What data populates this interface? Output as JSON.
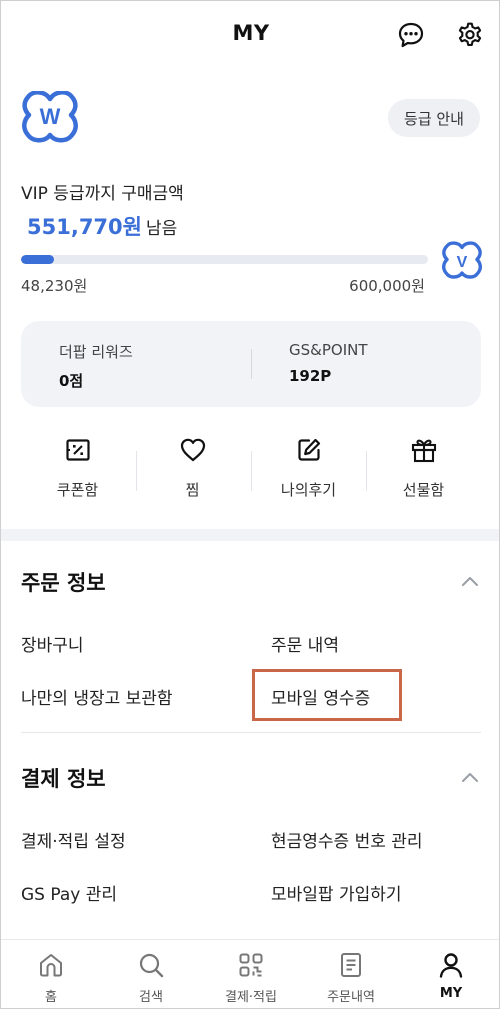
{
  "header": {
    "title": "MY",
    "chat_icon": "chat-bubble-icon",
    "settings_icon": "gear-icon"
  },
  "grade": {
    "guide_button": "등급 안내",
    "vip_label": "VIP 등급까지 구매금액",
    "remaining_amount": "551,770원",
    "remaining_suffix": "남음",
    "progress_fraction": 0.08,
    "current_amount": "48,230원",
    "target_amount": "600,000원",
    "brand_color": "#3b6fd8"
  },
  "points": [
    {
      "label": "더팝 리워즈",
      "value": "0점"
    },
    {
      "label": "GS&POINT",
      "value": "192P"
    }
  ],
  "quick_menu": [
    {
      "label": "쿠폰함",
      "icon": "coupon-icon"
    },
    {
      "label": "찜",
      "icon": "heart-icon"
    },
    {
      "label": "나의후기",
      "icon": "review-pencil-icon"
    },
    {
      "label": "선물함",
      "icon": "gift-icon"
    }
  ],
  "order_section": {
    "title": "주문 정보",
    "links": [
      "장바구니",
      "주문 내역",
      "나만의 냉장고 보관함",
      "모바일 영수증"
    ]
  },
  "payment_section": {
    "title": "결제 정보",
    "links": [
      "결제·적립 설정",
      "현금영수증 번호 관리",
      "GS Pay 관리",
      "모바일팝 가입하기"
    ]
  },
  "bottom_nav": [
    {
      "label": "홈",
      "icon": "home-icon"
    },
    {
      "label": "검색",
      "icon": "search-icon"
    },
    {
      "label": "결제·적립",
      "icon": "payment-grid-icon"
    },
    {
      "label": "주문내역",
      "icon": "order-list-icon"
    },
    {
      "label": "MY",
      "icon": "person-icon",
      "active": true
    }
  ],
  "highlight_color": "#c96748"
}
